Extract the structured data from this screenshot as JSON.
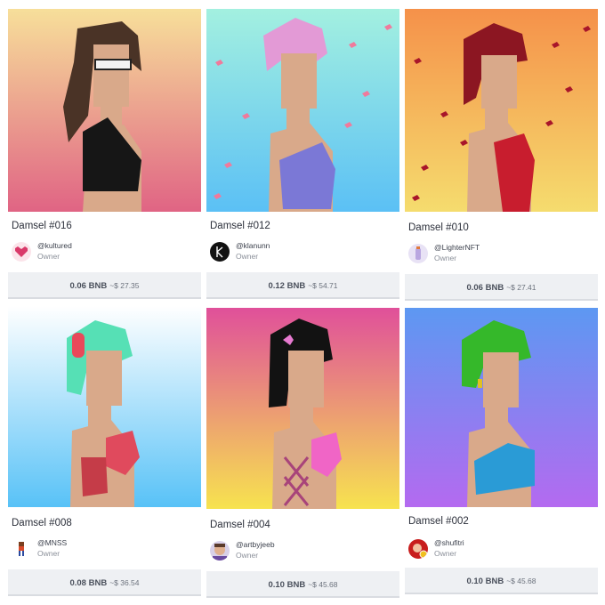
{
  "cards": [
    {
      "title": "Damsel #016",
      "handle": "@kultured",
      "role": "Owner",
      "price": "0.06 BNB",
      "usd": "~$ 27.35",
      "bg_top": "#f7df9a",
      "bg_bottom": "#e06484",
      "hair": "#4a3326",
      "top": "#161616",
      "avatar": "heart-avatar"
    },
    {
      "title": "Damsel #012",
      "handle": "@klanunn",
      "role": "Owner",
      "price": "0.12 BNB",
      "usd": "~$ 54.71",
      "bg_top": "#a3f0e0",
      "bg_bottom": "#5bc0f5",
      "hair": "#e39ad6",
      "top": "#7b78d6",
      "avatar": "k-avatar"
    },
    {
      "title": "Damsel #010",
      "handle": "@LighterNFT",
      "role": "Owner",
      "price": "0.06 BNB",
      "usd": "~$ 27.41",
      "bg_top": "#f5914a",
      "bg_bottom": "#f5dc6e",
      "hair": "#8c1622",
      "top": "#c81d2e",
      "avatar": "lighter-avatar"
    },
    {
      "title": "Damsel #008",
      "handle": "@MNSS",
      "role": "Owner",
      "price": "0.08 BNB",
      "usd": "~$ 36.54",
      "bg_top": "#ffffff",
      "bg_bottom": "#58c2f7",
      "hair": "#56e0b5",
      "top": "#e04a5d",
      "avatar": "pixel-person-avatar"
    },
    {
      "title": "Damsel #004",
      "handle": "@artbyjeeb",
      "role": "Owner",
      "price": "0.10 BNB",
      "usd": "~$ 45.68",
      "bg_top": "#e0509a",
      "bg_bottom": "#f7e34f",
      "hair": "#121212",
      "top": "#f065c6",
      "avatar": "face-avatar"
    },
    {
      "title": "Damsel #002",
      "handle": "@shufitri",
      "role": "Owner",
      "price": "0.10 BNB",
      "usd": "~$ 45.68",
      "bg_top": "#5d98f2",
      "bg_bottom": "#b46af0",
      "hair": "#35b82a",
      "top": "#2a9bd6",
      "avatar": "red-avatar"
    }
  ],
  "colors": {
    "skin": "#d9a98a",
    "skin_shadow": "#b8826a",
    "price_bg": "#eef0f3"
  }
}
